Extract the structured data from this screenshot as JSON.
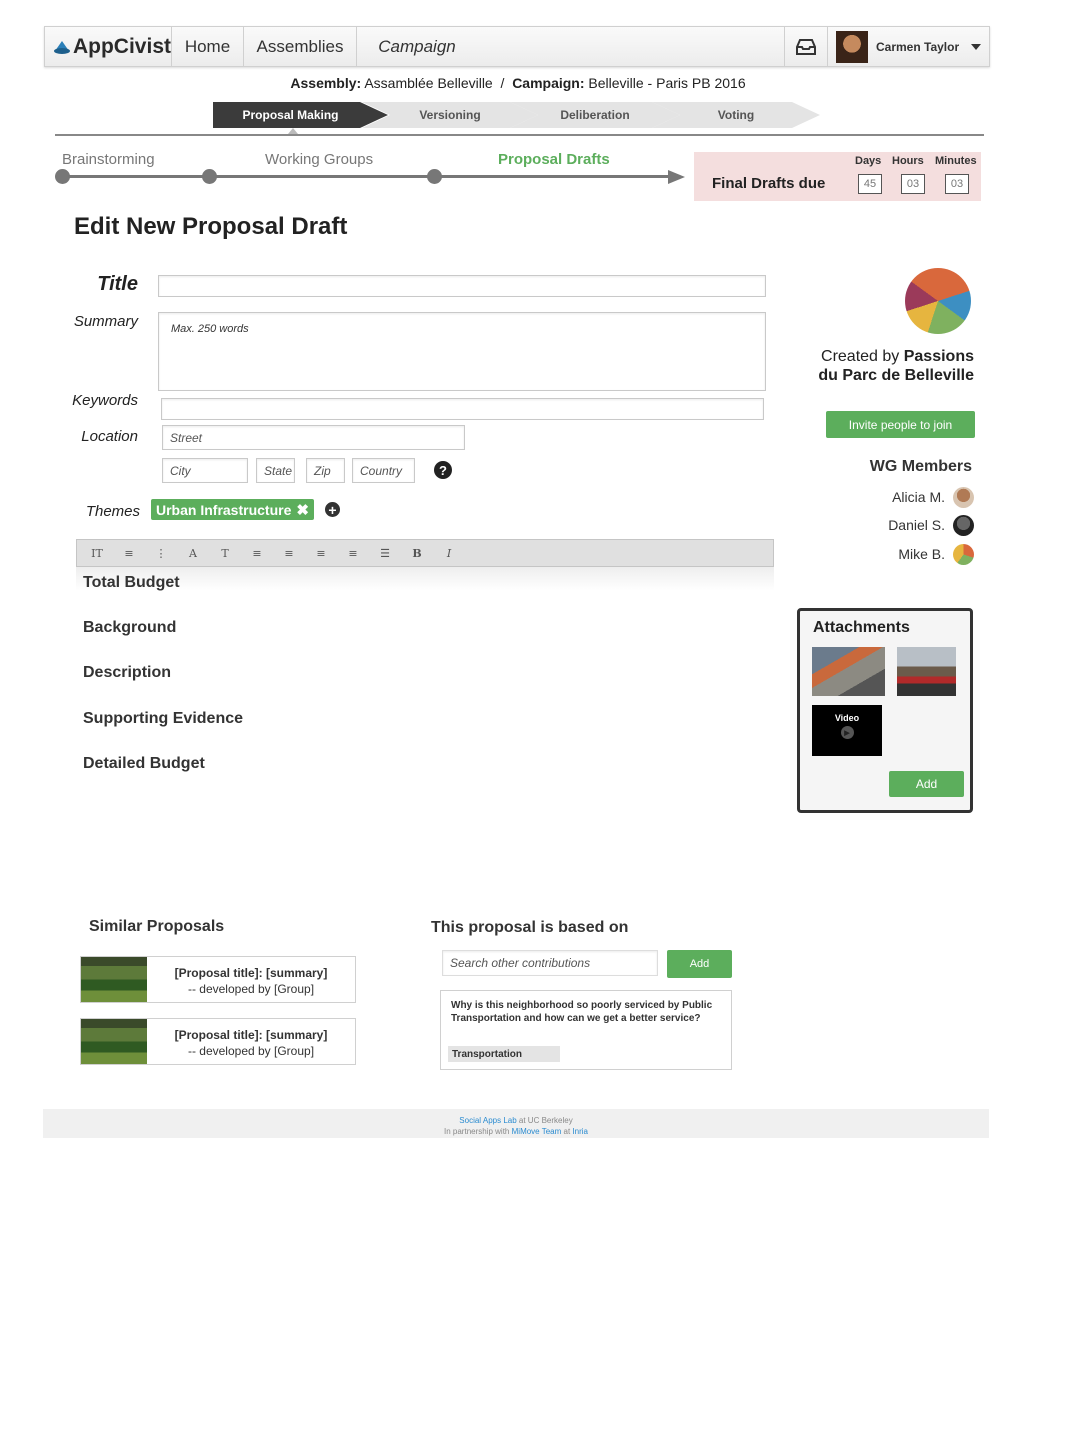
{
  "nav": {
    "logo": "AppCivist",
    "home": "Home",
    "assemblies": "Assemblies",
    "campaign": "Campaign",
    "user_name": "Carmen Taylor"
  },
  "breadcrumb": {
    "assembly_label": "Assembly:",
    "assembly_value": "Assamblée Belleville",
    "separator": "/",
    "campaign_label": "Campaign:",
    "campaign_value": "Belleville - Paris PB 2016"
  },
  "phases": [
    "Proposal Making",
    "Versioning",
    "Deliberation",
    "Voting"
  ],
  "stages": [
    "Brainstorming",
    "Working Groups",
    "Proposal Drafts"
  ],
  "countdown": {
    "label": "Final Drafts due",
    "days_label": "Days",
    "hours_label": "Hours",
    "minutes_label": "Minutes",
    "days": "45",
    "hours": "03",
    "minutes": "03"
  },
  "form": {
    "page_title": "Edit New Proposal Draft",
    "title_label": "Title",
    "summary_label": "Summary",
    "summary_placeholder": "Max. 250 words",
    "keywords_label": "Keywords",
    "location_label": "Location",
    "street_placeholder": "Street",
    "city_placeholder": "City",
    "state_placeholder": "State",
    "zip_placeholder": "Zip",
    "country_placeholder": "Country",
    "themes_label": "Themes",
    "theme_tag": "Urban Infrastructure"
  },
  "toolbar": [
    "IT",
    "≡",
    "⋮",
    "A",
    "T",
    "≡",
    "≡",
    "≡",
    "≡",
    "☰",
    "B",
    "I"
  ],
  "sections": [
    "Total Budget",
    "Background",
    "Description",
    "Supporting Evidence",
    "Detailed Budget"
  ],
  "sidebar": {
    "created_by_prefix": "Created by",
    "created_by_group_line1": "Passions",
    "created_by_group_line2": "du Parc de Belleville",
    "invite_button": "Invite people to join",
    "wg_members_title": "WG Members",
    "members": [
      "Alicia M.",
      "Daniel S.",
      "Mike B."
    ],
    "attachments_title": "Attachments",
    "video_label": "Video",
    "attach_add": "Add"
  },
  "similar": {
    "title": "Similar Proposals",
    "items": [
      {
        "title": "[Proposal title]: [summary]",
        "group": "-- developed by [Group]"
      },
      {
        "title": "[Proposal title]: [summary]",
        "group": "-- developed by [Group]"
      }
    ]
  },
  "based_on": {
    "title": "This proposal is based on",
    "search_placeholder": "Search other contributions",
    "add_button": "Add",
    "card_text": "Why is this neighborhood so poorly serviced by Public Transportation and how can we get a better service?",
    "card_tag": "Transportation"
  },
  "footer": {
    "lab": "Social Apps Lab",
    "at1": "at UC Berkeley",
    "partner_prefix": "In partnership with",
    "team": "MiMove Team",
    "at2": "at",
    "inria": "Inria"
  },
  "colors": {
    "accent_green": "#5cae5c",
    "countdown_bg": "#f4dede",
    "active_phase": "#3b3b3b"
  }
}
